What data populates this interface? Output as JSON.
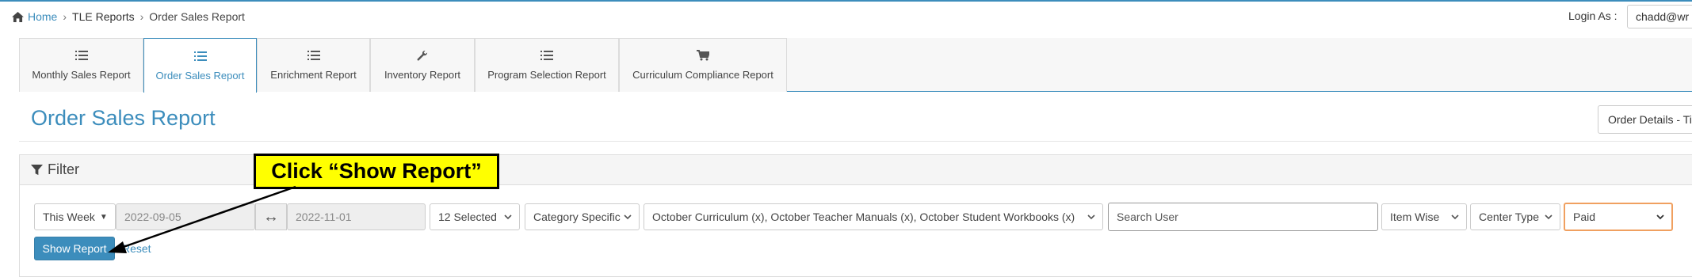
{
  "breadcrumb": {
    "home": "Home",
    "section": "TLE Reports",
    "current": "Order Sales Report"
  },
  "login": {
    "label": "Login As :",
    "value": "chadd@wr"
  },
  "tabs": [
    {
      "label": "Monthly Sales Report",
      "icon": "list-icon",
      "active": false
    },
    {
      "label": "Order Sales Report",
      "icon": "list-icon",
      "active": true
    },
    {
      "label": "Enrichment Report",
      "icon": "list-icon",
      "active": false
    },
    {
      "label": "Inventory Report",
      "icon": "wrench-icon",
      "active": false
    },
    {
      "label": "Program Selection Report",
      "icon": "list-icon",
      "active": false
    },
    {
      "label": "Curriculum Compliance Report",
      "icon": "cart-icon",
      "active": false
    }
  ],
  "page": {
    "title": "Order Sales Report",
    "details_button": "Order Details - Ti"
  },
  "filter": {
    "heading": "Filter",
    "period": "This Week",
    "start_date": "2022-09-05",
    "end_date": "2022-11-01",
    "selected_count": "12 Selected",
    "category_mode": "Category Specific",
    "categories": "October Curriculum (x), October Teacher Manuals (x), October Student Workbooks (x)",
    "search_placeholder": "Search User",
    "grouping": "Item Wise",
    "center_type": "Center Type",
    "status": "Paid",
    "show_report": "Show Report",
    "reset": "Reset"
  },
  "annotation": {
    "callout": "Click “Show Report”"
  },
  "colors": {
    "accent": "#3c8dbc",
    "callout_bg": "#ffff00",
    "status_border": "#f0a060"
  }
}
